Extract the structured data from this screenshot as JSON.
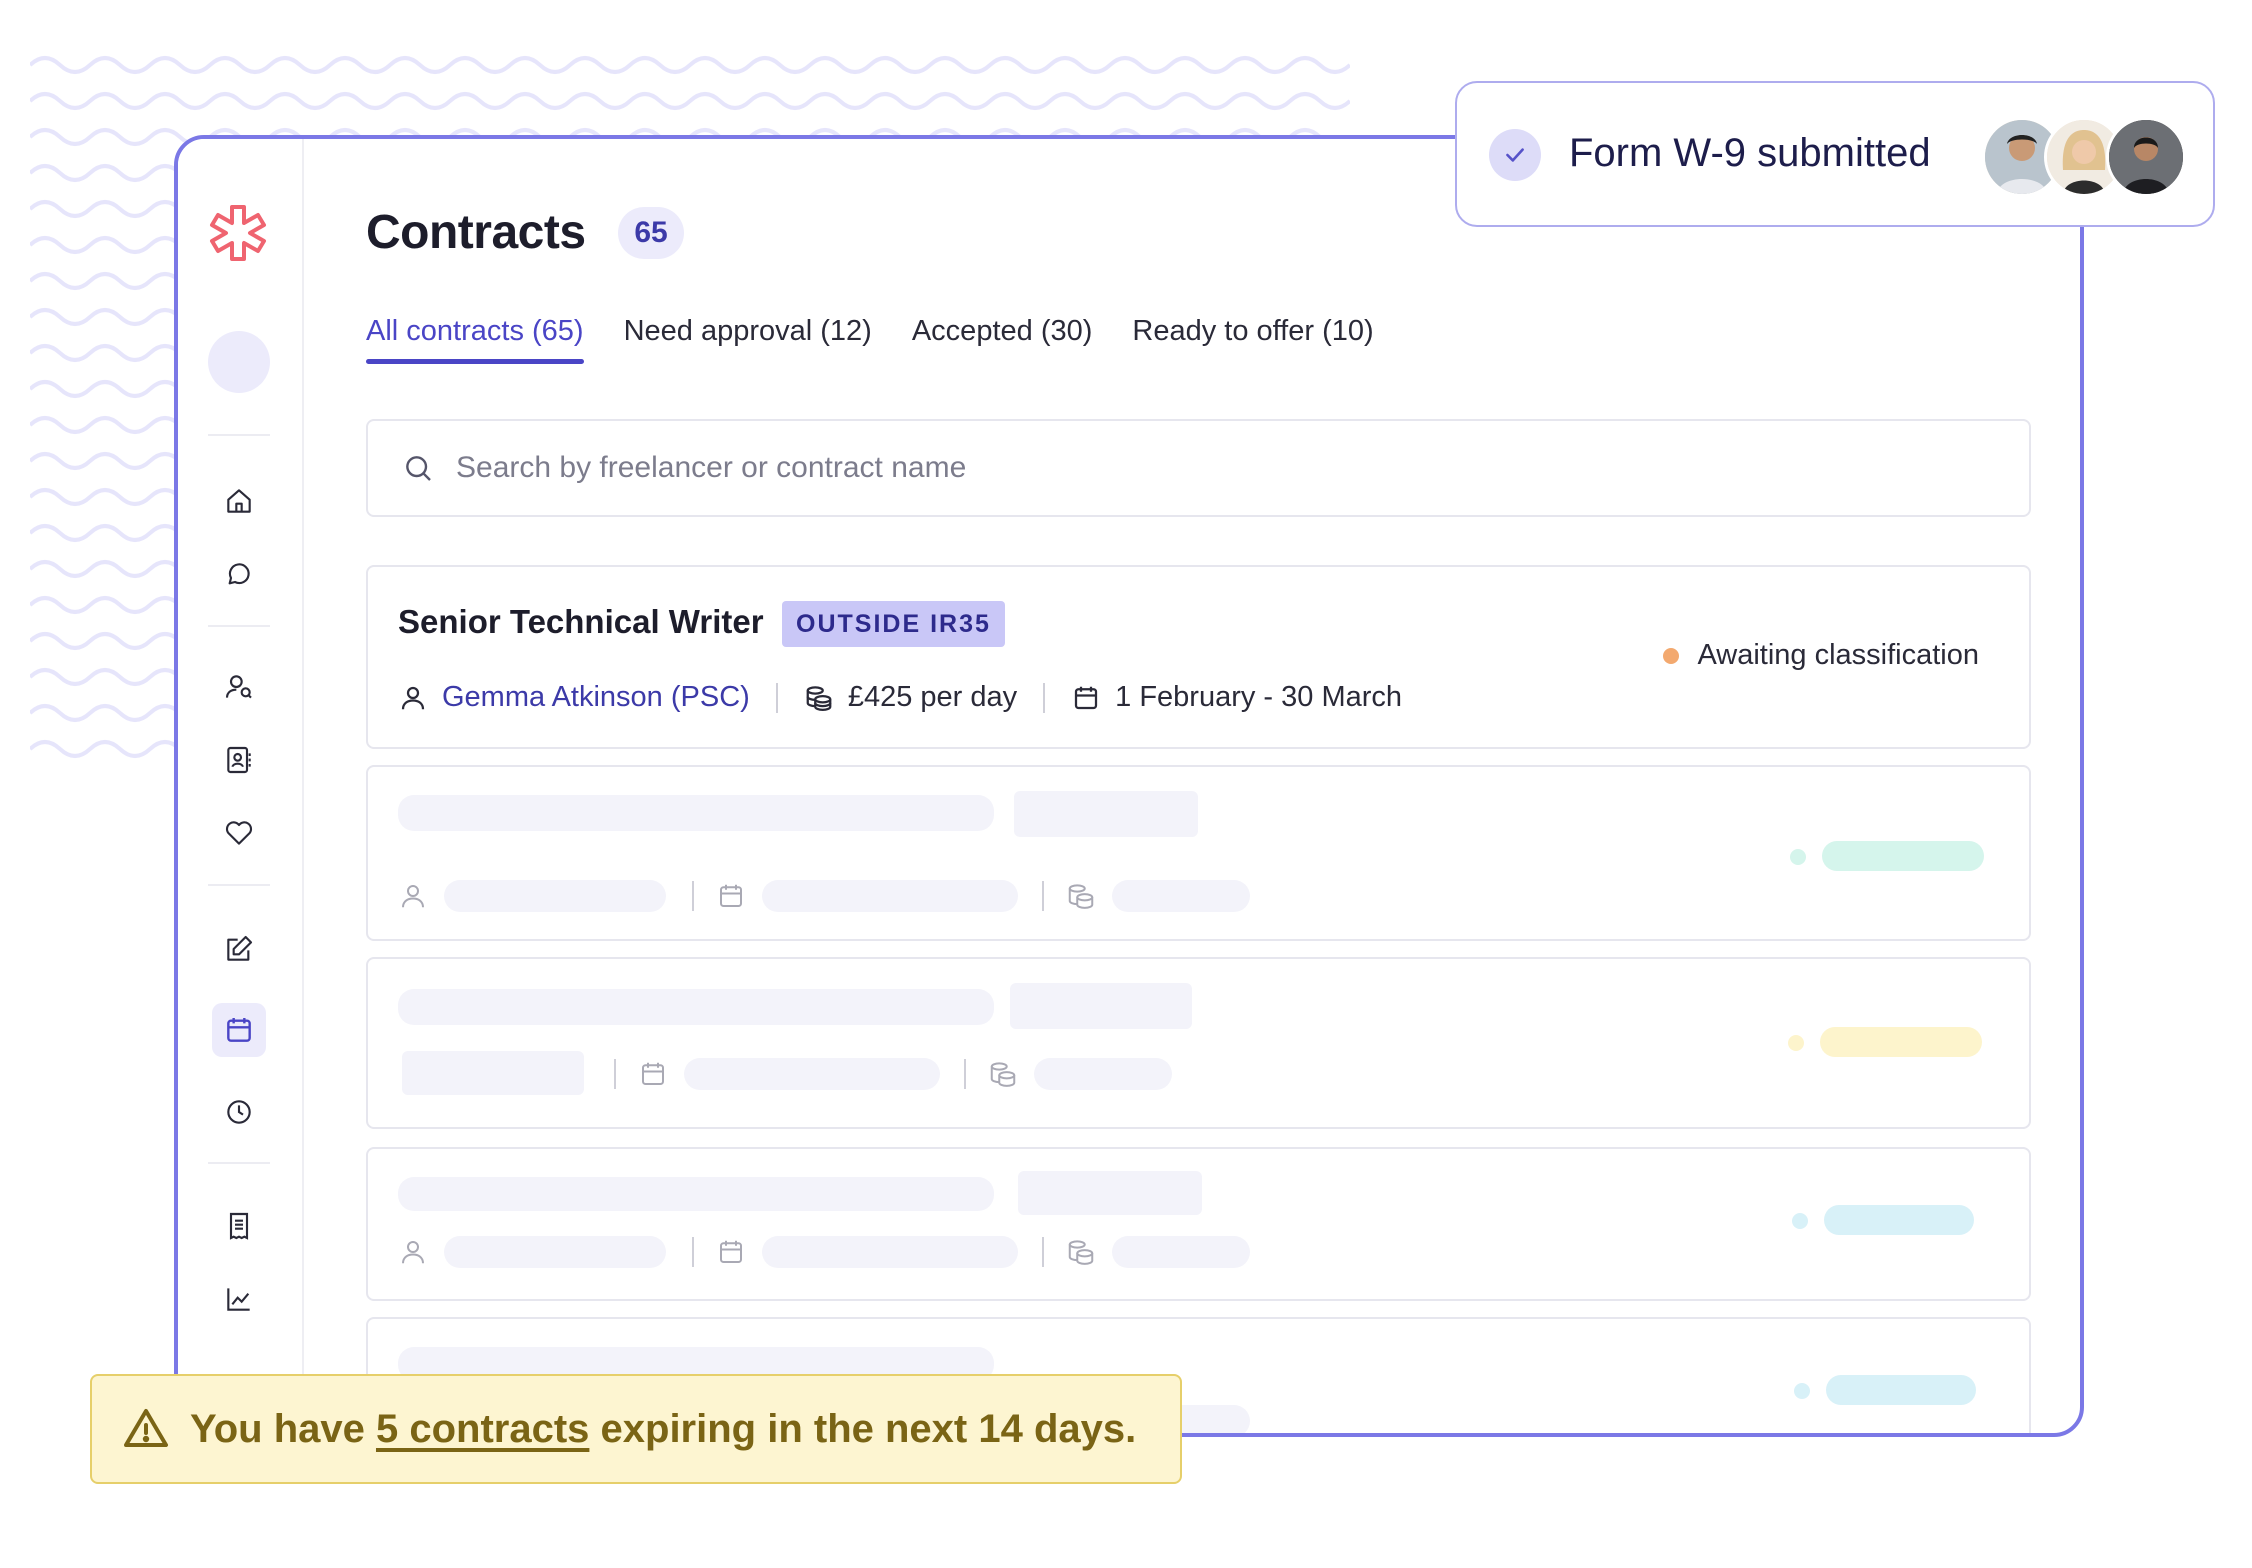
{
  "page": {
    "title": "Contracts",
    "count": "65"
  },
  "tabs": [
    {
      "label": "All contracts (65)",
      "active": true
    },
    {
      "label": "Need approval (12)"
    },
    {
      "label": "Accepted (30)"
    },
    {
      "label": "Ready to offer (10)"
    }
  ],
  "search": {
    "placeholder": "Search by freelancer or contract name"
  },
  "contract": {
    "title": "Senior Technical Writer",
    "badge": "OUTSIDE IR35",
    "freelancer": "Gemma Atkinson (PSC)",
    "rate": "£425 per day",
    "dates": "1 February - 30 March",
    "status": "Awaiting classification",
    "status_color": "#f3a96f"
  },
  "skeleton_status_colors": [
    "#d5f5ec",
    "#fdf4cc",
    "#d8f1f8",
    "#d8f1f8"
  ],
  "notification": {
    "text": "Form W-9 submitted"
  },
  "warning": {
    "prefix": "You have ",
    "link": "5 contracts",
    "suffix": " expiring in the next 14 days."
  },
  "sidebar": {
    "icons": [
      "home-icon",
      "chat-icon",
      "find-talent-icon",
      "contacts-icon",
      "favourites-icon",
      "edit-icon",
      "calendar-icon",
      "clock-icon",
      "receipt-icon",
      "chart-icon"
    ],
    "active": "calendar-icon"
  },
  "colors": {
    "accent": "#4a45c6",
    "window_border": "#7b78e6",
    "warning_bg": "#fdf5d1",
    "warning_text": "#7a6415"
  }
}
